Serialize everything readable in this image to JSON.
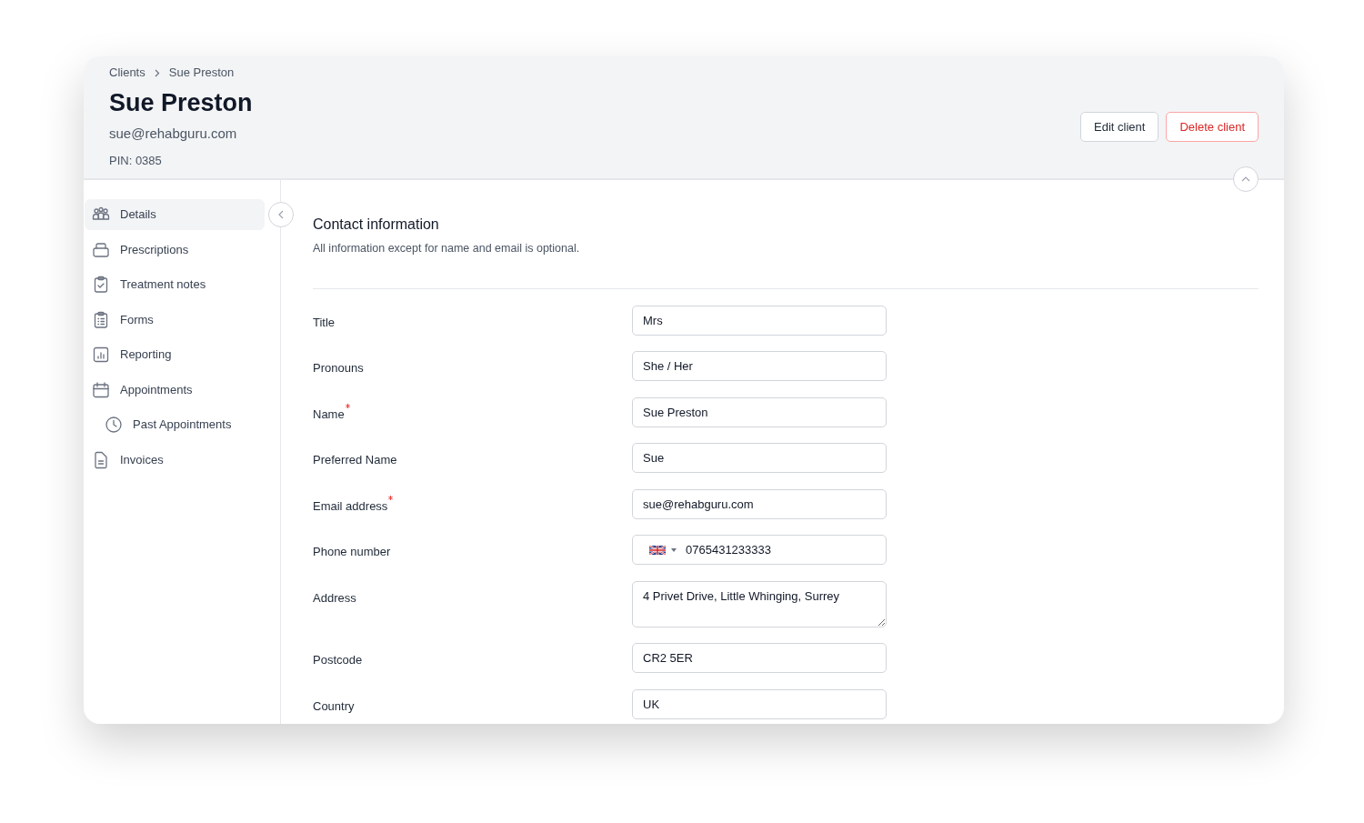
{
  "breadcrumb": [
    "Clients",
    "Sue Preston"
  ],
  "client": {
    "name": "Sue Preston",
    "email": "sue@rehabguru.com",
    "pin": "PIN: 0385"
  },
  "actions": [
    {
      "label": "Edit client",
      "kind": "default"
    },
    {
      "label": "Delete client",
      "kind": "danger"
    }
  ],
  "sidebar": {
    "items": [
      {
        "label": "Details",
        "selected": true
      },
      {
        "label": "Prescriptions",
        "selected": false
      },
      {
        "label": "Treatment notes",
        "selected": false
      },
      {
        "label": "Forms",
        "selected": false
      },
      {
        "label": "Reporting",
        "selected": false
      },
      {
        "label": "Appointments",
        "selected": false,
        "children": [
          {
            "label": "Past Appointments",
            "selected": false
          }
        ]
      },
      {
        "label": "Invoices",
        "selected": false
      }
    ]
  },
  "section": {
    "title": "Contact information",
    "description": "All information except for name and email is optional."
  },
  "fields": [
    {
      "label": "Title",
      "kind": "text",
      "value": "Mrs",
      "required": false
    },
    {
      "label": "Pronouns",
      "kind": "text",
      "value": "She / Her",
      "required": false
    },
    {
      "label": "Name",
      "kind": "text",
      "value": "Sue Preston",
      "required": true
    },
    {
      "label": "Preferred Name",
      "kind": "text",
      "value": "Sue",
      "required": false
    },
    {
      "label": "Email address",
      "kind": "text",
      "value": "sue@rehabguru.com",
      "required": true
    },
    {
      "label": "Phone number",
      "kind": "phone",
      "value": "0765431233333",
      "required": false
    },
    {
      "label": "Address",
      "kind": "textarea",
      "value": "4 Privet Drive, Little Whinging, Surrey",
      "required": false
    },
    {
      "label": "Postcode",
      "kind": "text",
      "value": "CR2 5ER",
      "required": false
    },
    {
      "label": "Country",
      "kind": "text",
      "value": "UK",
      "required": false
    }
  ]
}
